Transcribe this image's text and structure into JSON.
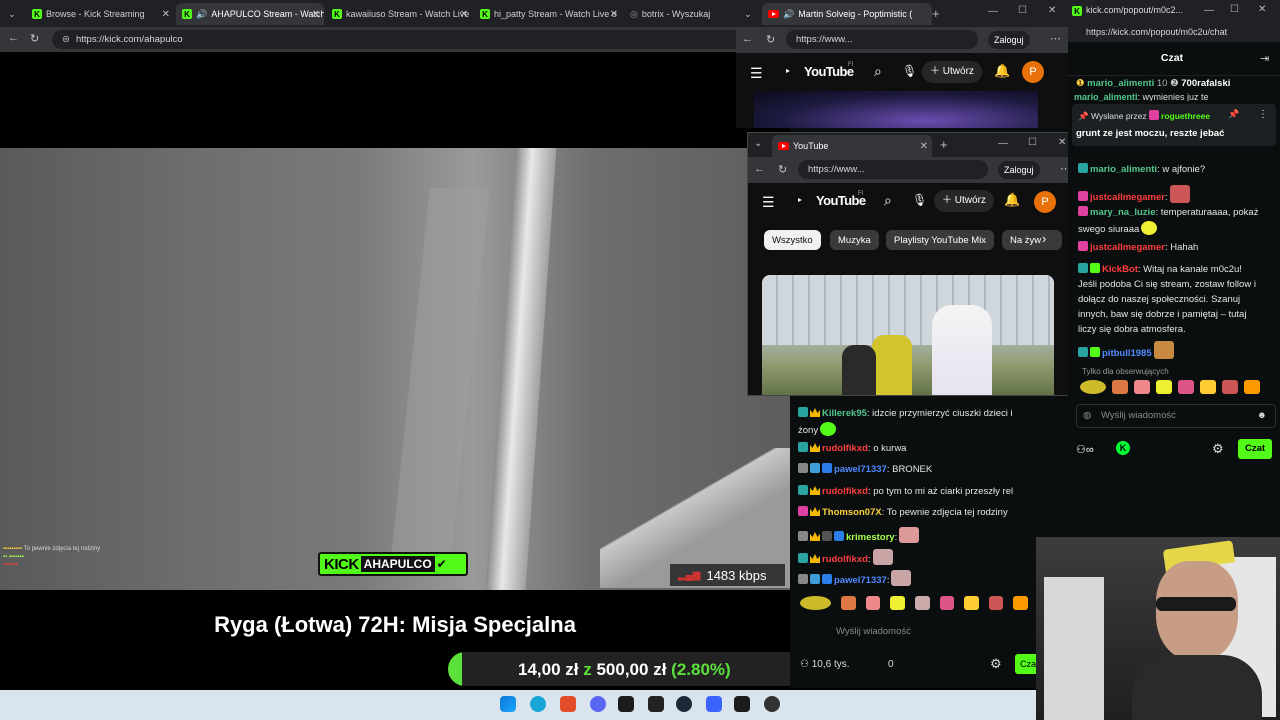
{
  "browser_main": {
    "tabs": [
      {
        "label": "Browse - Kick Streaming",
        "active": false
      },
      {
        "label": "AHAPULCO Stream - Watch",
        "active": true
      },
      {
        "label": "kawaiiuso Stream - Watch Live",
        "active": false
      },
      {
        "label": "hi_patty Stream - Watch Live o",
        "active": false
      },
      {
        "label": "botrix - Wyszukaj",
        "active": false
      }
    ],
    "url": "https://kick.com/ahapulco"
  },
  "stream_video": {
    "logo_text": "KICK",
    "channel": "AHAPULCO",
    "bitrate": "1483 kbps",
    "overlay_chat": "To pewnie zdjęcia tej rodziny",
    "title": "Ryga (Łotwa) 72H: Misja Specjalna",
    "goal_current": "14,00 zł",
    "goal_sep": "z",
    "goal_target": "500,00 zł",
    "goal_percent": "(2.80%)"
  },
  "youtube_back": {
    "tab_title": "Martin Solveig - Poptimistic (",
    "url": "https://www...",
    "login": "Zaloguj",
    "brand": "YouTube",
    "region": "FI",
    "create": "Utwórz",
    "avatar": "P"
  },
  "youtube_front": {
    "tab_title": "YouTube",
    "url": "https://www...",
    "login": "Zaloguj",
    "brand": "YouTube",
    "region": "FI",
    "create": "Utwórz",
    "avatar": "P",
    "chips": [
      "Wszystko",
      "Muzyka",
      "Playlisty YouTube Mix",
      "Na żyw"
    ]
  },
  "kick_chat_mid": {
    "messages": [
      {
        "user": "Killerek95",
        "text": ": idzcie przymierzyć ciuszki dzieci i",
        "cont": "żony",
        "color": "#53c68c"
      },
      {
        "user": "rudolfikxd",
        "text": ": o kurwa",
        "color": "#ff3d3d"
      },
      {
        "user": "pawel71337",
        "text": ": BRONEK",
        "color": "#4f8cff"
      },
      {
        "user": "rudolfikxd",
        "text": ": po tym to mi aż ciarki przeszły rel",
        "color": "#ff3d3d"
      },
      {
        "user": "Thomson07X",
        "text": ": To pewnie zdjęcia tej rodziny",
        "color": "#ffd23c"
      },
      {
        "user": "krimestory",
        "text": ":",
        "color": "#a6ff4d"
      },
      {
        "user": "rudolfikxd",
        "text": ":",
        "color": "#ff3d3d"
      },
      {
        "user": "pawel71337",
        "text": ":",
        "color": "#4f8cff"
      }
    ],
    "input_placeholder": "Wyślij wiadomość",
    "viewers": "10,6 tys.",
    "points": "0",
    "send": "Cza"
  },
  "popout": {
    "url_top": "kick.com/popout/m0c2...",
    "url": "https://kick.com/popout/m0c2u/chat",
    "title": "Czat",
    "top_gifters": [
      {
        "name": "mario_alimenti",
        "count": "10"
      },
      {
        "name": "700rafalski",
        "count": "1"
      }
    ],
    "pinned_prefix": "Wysłane przez",
    "pinned_by": "roguethreee",
    "pinned_cut_user": "mario_alimenti",
    "pinned_cut_text": ": wymienies juz te",
    "pinned_text": "grunt ze jest moczu, reszte jebać",
    "messages": [
      {
        "user": "mario_alimenti",
        "text": ": w ajfonie?",
        "color": "#53c68c"
      },
      {
        "user": "justcallmegamer",
        "text": ":",
        "color": "#ff3d3d"
      },
      {
        "user": "mary_na_luzie",
        "text": ": temperaturaaaa, pokaż",
        "cont": "swego siuraaa",
        "color": "#53c68c"
      },
      {
        "user": "justcallmegamer",
        "text": ": Hahah",
        "color": "#ff3d3d"
      }
    ],
    "bot_user": "KickBot",
    "bot_lines": [
      ": Witaj na kanale m0c2u!",
      "Jeśli podoba Ci się stream, zostaw follow i",
      "dołącz do naszej społeczności. Szanuj",
      "innych, baw się dobrze i pamiętaj – tutaj",
      "liczy się dobra atmosfera."
    ],
    "last_user": "pitbull1985",
    "followers_only": "Tylko dla obserwujących",
    "input_placeholder": "Wyślij wiadomość",
    "send": "Czat"
  },
  "colors": {
    "kick_green": "#53fc18",
    "yt_red": "#ff0000",
    "goal_green": "#5ce03c"
  }
}
